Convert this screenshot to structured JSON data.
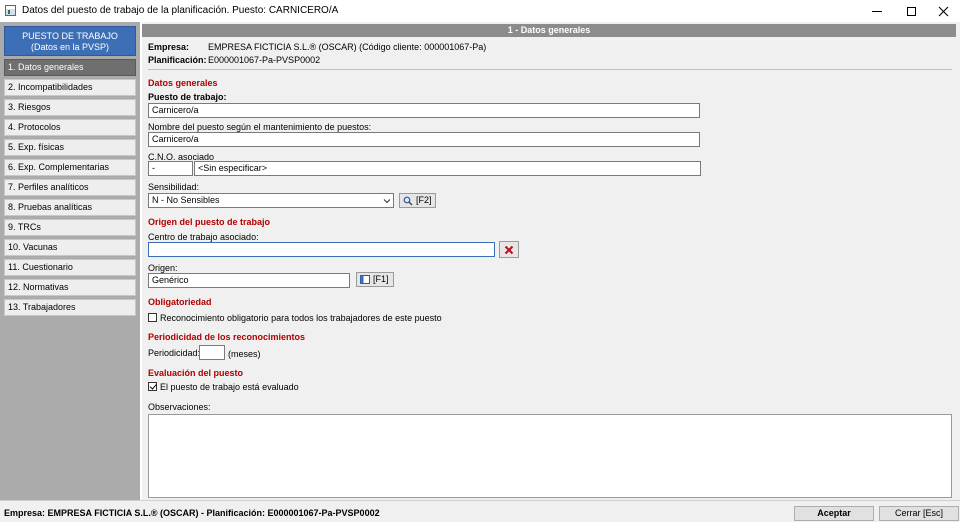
{
  "window": {
    "title": "Datos del puesto de trabajo de la planificación.  Puesto: CARNICERO/A"
  },
  "sidebar": {
    "header_line1": "PUESTO DE TRABAJO",
    "header_line2": "(Datos en la PVSP)",
    "items": [
      {
        "label": "1. Datos generales",
        "active": true
      },
      {
        "label": "2. Incompatibilidades"
      },
      {
        "label": "3. Riesgos"
      },
      {
        "label": "4. Protocolos"
      },
      {
        "label": "5. Exp. físicas"
      },
      {
        "label": "6. Exp. Complementarias"
      },
      {
        "label": "7. Perfiles analíticos"
      },
      {
        "label": "8. Pruebas analíticas"
      },
      {
        "label": "9. TRCs"
      },
      {
        "label": "10. Vacunas"
      },
      {
        "label": "11. Cuestionario"
      },
      {
        "label": "12. Normativas"
      },
      {
        "label": "13. Trabajadores"
      }
    ]
  },
  "main": {
    "section_title": "1 - Datos generales",
    "empresa_label": "Empresa:",
    "empresa_value": "EMPRESA FICTICIA S.L.® (OSCAR) (Código cliente: 000001067-Pa)",
    "planificacion_label": "Planificación:",
    "planificacion_value": "E000001067-Pa-PVSP0002",
    "datos_generales_heading": "Datos generales",
    "puesto_label": "Puesto de trabajo:",
    "puesto_value": "Carnicero/a",
    "nombre_label": "Nombre del puesto según el mantenimiento de puestos:",
    "nombre_value": "Carnicero/a",
    "cno_label": "C.N.O. asociado",
    "cno_code": "-",
    "cno_desc": "<Sin especificar>",
    "sensibilidad_label": "Sensibilidad:",
    "sensibilidad_value": "N - No Sensibles",
    "sensibilidad_btn": "[F2]",
    "origen_heading": "Origen del puesto de trabajo",
    "centro_label": "Centro de trabajo asociado:",
    "centro_value": "",
    "origen_label": "Origen:",
    "origen_value": "Genérico",
    "origen_btn": "[F1]",
    "obligatoriedad_heading": "Obligatoriedad",
    "obligatorio_label": "Reconocimiento obligatorio para todos los trabajadores de este puesto",
    "obligatorio_checked": false,
    "periodicidad_heading": "Periodicidad de los reconocimientos",
    "periodicidad_label": "Periodicidad:",
    "periodicidad_value": "",
    "periodicidad_unit": "(meses)",
    "evaluacion_heading": "Evaluación del puesto",
    "evaluado_label": "El puesto de trabajo está evaluado",
    "evaluado_checked": true,
    "observaciones_label": "Observaciones:"
  },
  "status": {
    "text": "Empresa: EMPRESA FICTICIA S.L.® (OSCAR) - Planificación: E000001067-Pa-PVSP0002",
    "accept_label": "Aceptar",
    "close_label": "Cerrar [Esc]"
  },
  "colors": {
    "accent": "#3c6fb6",
    "heading_red": "#b00000",
    "sidebar_bg": "#ababab",
    "active_item": "#6f6f6f"
  }
}
